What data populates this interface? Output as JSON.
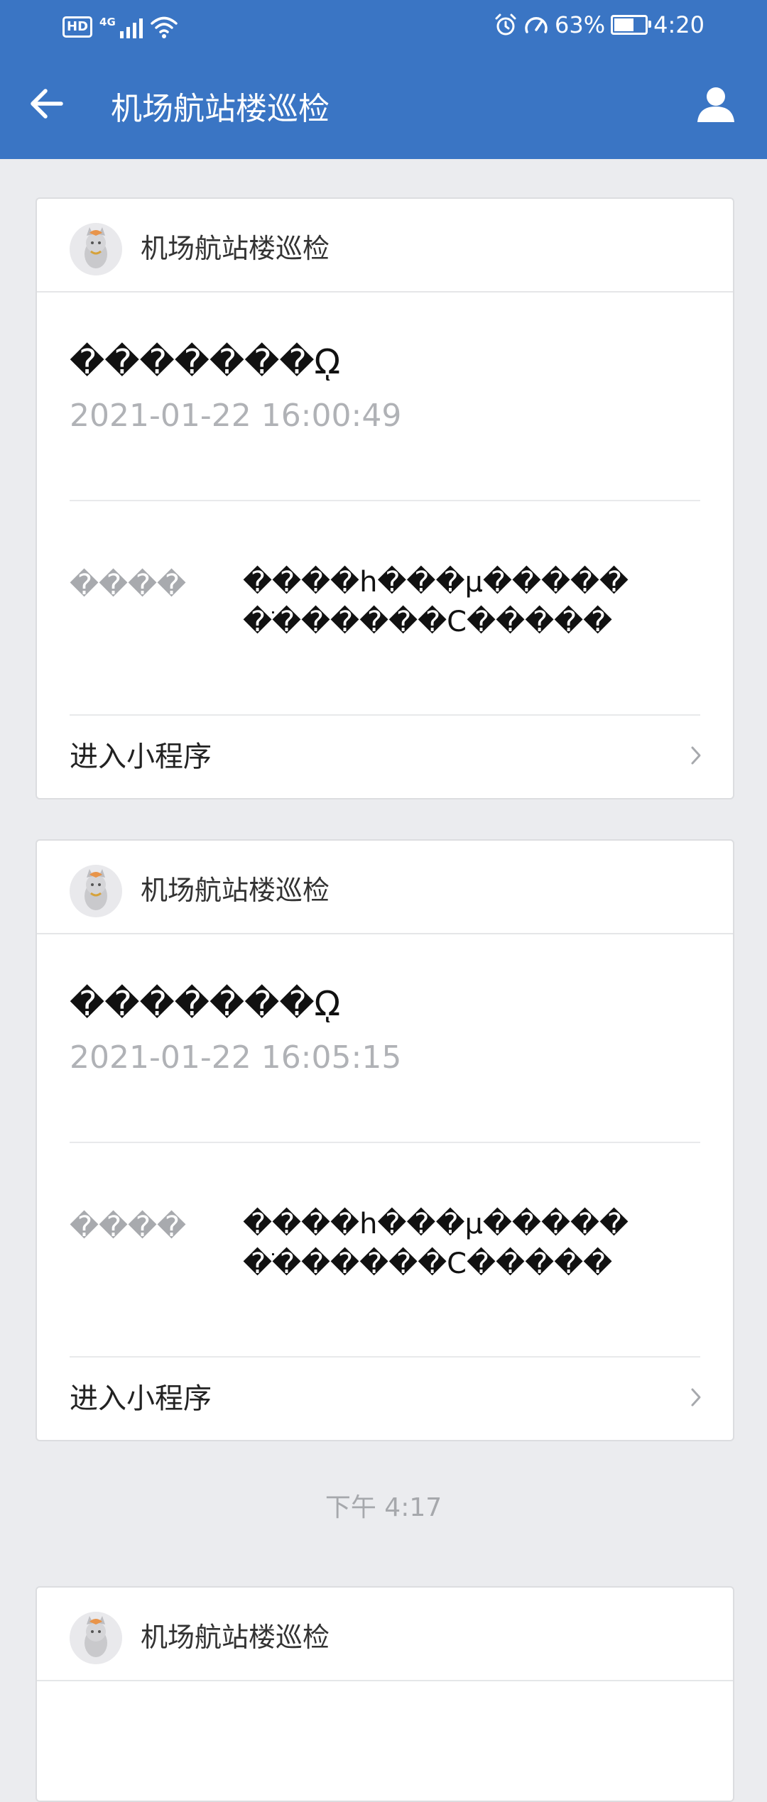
{
  "status_bar": {
    "hd": "HD",
    "network": "4G",
    "battery_text": "63%",
    "battery_level": 0.63,
    "time": "4:20"
  },
  "nav": {
    "title": "机场航站楼巡检"
  },
  "messages": [
    {
      "account_name": "机场航站楼巡检",
      "title": "�������ῼ",
      "timestamp": "2021-01-22 16:00:49",
      "field_label": "����",
      "field_value": "����h���µ������ֹ������C�����",
      "action_label": "进入小程序"
    },
    {
      "account_name": "机场航站楼巡检",
      "title": "�������ῼ",
      "timestamp": "2021-01-22 16:05:15",
      "field_label": "����",
      "field_value": "����h���µ������ֹ������C�����",
      "action_label": "进入小程序"
    },
    {
      "account_name": "机场航站楼巡检"
    }
  ],
  "time_separator": "下午 4:17",
  "colors": {
    "header": "#3a75c4",
    "background": "#ebecef",
    "card": "#ffffff"
  }
}
